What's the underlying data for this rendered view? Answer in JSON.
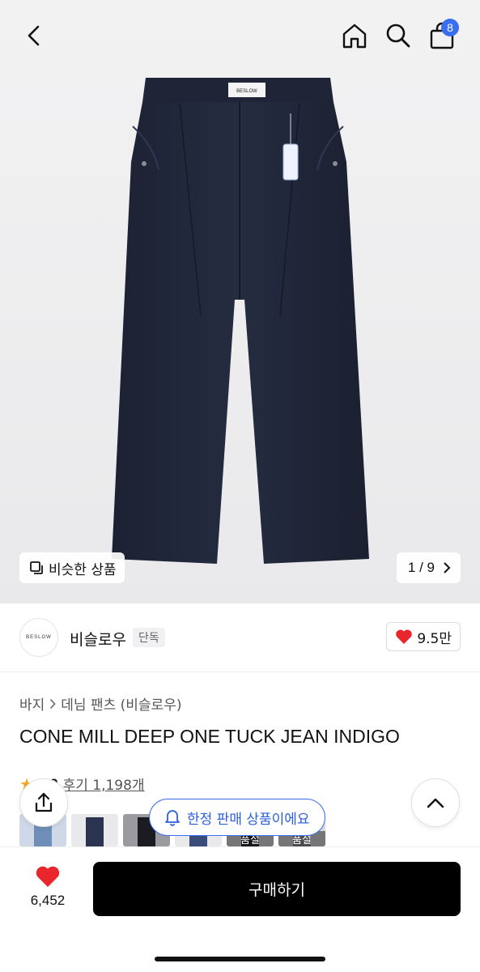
{
  "header": {
    "cart_count": "8",
    "icons": [
      "chevron-left-icon",
      "home-icon",
      "search-icon",
      "shopping-bag-icon"
    ]
  },
  "hero": {
    "similar_label": "비슷한 상품",
    "page_indicator": "1 / 9",
    "brand_tag": "BESLOW"
  },
  "brand": {
    "logo_text": "BESLOW",
    "name": "비슬로우",
    "exclusive_label": "단독",
    "likes": "9.5만"
  },
  "product": {
    "breadcrumb": [
      "바지",
      "데님 팬츠 (비슬로우)"
    ],
    "title": "CONE MILL DEEP ONE TUCK JEAN INDIGO",
    "rating": "4.9",
    "reviews": "후기 1,198개"
  },
  "thumbnails": [
    {
      "color": "#6f8fb8",
      "tag": ""
    },
    {
      "color": "#2a3450",
      "tag": ""
    },
    {
      "color": "#1a1c22",
      "tag": ""
    },
    {
      "color": "#3a4d7a",
      "tag": ""
    },
    {
      "color": "#2b2b2f",
      "tag": "품절"
    },
    {
      "color": "#8a8a90",
      "tag": "품절"
    }
  ],
  "floating": {
    "limited_label": "한정 판매 상품이에요"
  },
  "bottom": {
    "wish_count": "6,452",
    "buy_label": "구매하기"
  },
  "colors": {
    "accent": "#3a6ef0",
    "like_red": "#e8262b",
    "buy_button": "#000000"
  }
}
